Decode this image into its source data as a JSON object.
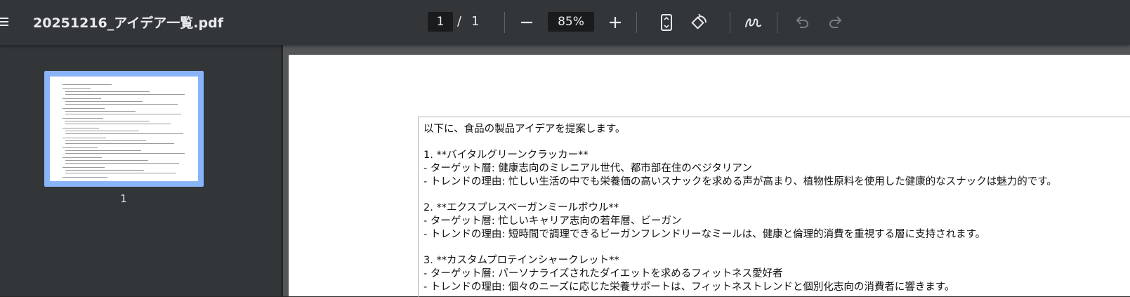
{
  "toolbar": {
    "title": "20251216_アイデア一覧.pdf",
    "page_current": "1",
    "page_separator": "/",
    "page_total": "1",
    "zoom": "85%",
    "icons": [
      "menu-icon",
      "zoom-out-icon",
      "zoom-in-icon",
      "fit-page-icon",
      "rotate-icon",
      "draw-icon",
      "undo-icon",
      "redo-icon"
    ]
  },
  "sidebar": {
    "thumbnails": [
      {
        "label": "1"
      }
    ]
  },
  "document": {
    "lines": [
      "以下に、食品の製品アイデアを提案します。",
      "",
      "1. **バイタルグリーンクラッカー**",
      "   - ターゲット層: 健康志向のミレニアル世代、都市部在住のベジタリアン",
      "   - トレンドの理由: 忙しい生活の中でも栄養価の高いスナックを求める声が高まり、植物性原料を使用した健康的なスナックは魅力的です。",
      "",
      "2. **エクスプレスベーガンミールボウル**",
      "   - ターゲット層: 忙しいキャリア志向の若年層、ビーガン",
      "   - トレンドの理由: 短時間で調理できるビーガンフレンドリーなミールは、健康と倫理的消費を重視する層に支持されます。",
      "",
      "3. **カスタムプロテインシャークレット**",
      "   - ターゲット層: パーソナライズされたダイエットを求めるフィットネス愛好者",
      "   - トレンドの理由: 個々のニーズに応じた栄養サポートは、フィットネストレンドと個別化志向の消費者に響きます。"
    ]
  },
  "colors": {
    "toolbar_bg": "#323639",
    "sidebar_bg": "#323639",
    "viewer_bg": "#525659",
    "thumbnail_highlight": "#8ab4f8",
    "icon_color": "#e8eaed",
    "disabled_icon": "#7a7d80"
  }
}
